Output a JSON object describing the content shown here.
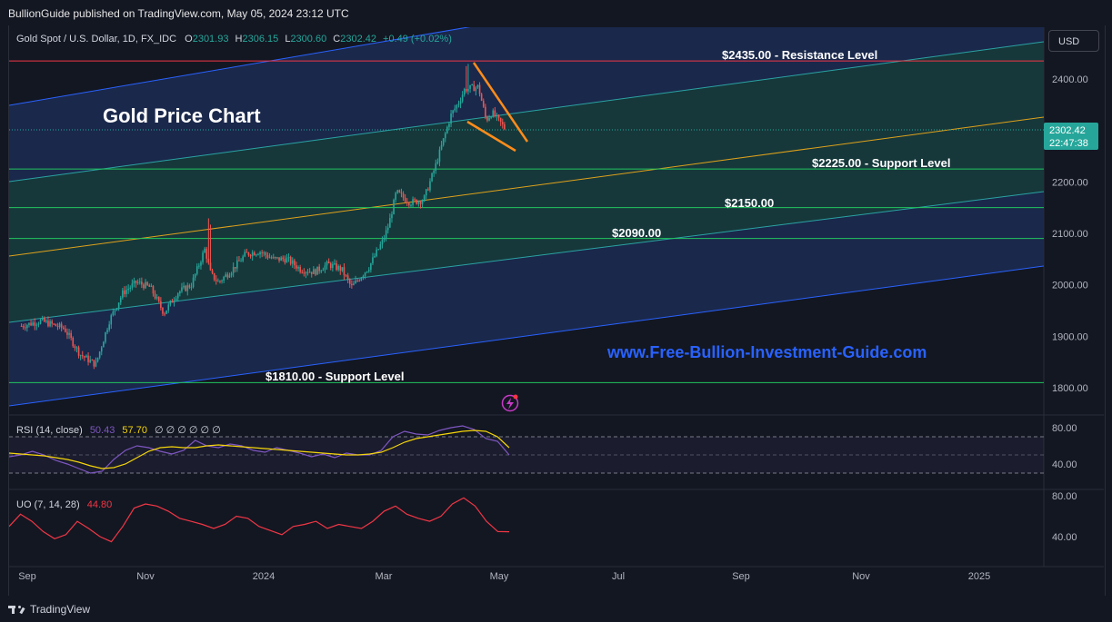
{
  "header": {
    "published": "BullionGuide published on TradingView.com, May 05, 2024 23:12 UTC"
  },
  "footer": {
    "brand": "TradingView"
  },
  "currency_button": "USD",
  "legend": {
    "symbol": "Gold Spot / U.S. Dollar, 1D, FX_IDC",
    "o_label": "O",
    "o": "2301.93",
    "h_label": "H",
    "h": "2306.15",
    "l_label": "L",
    "l": "2300.60",
    "c_label": "C",
    "c": "2302.42",
    "change": "+0.49 (+0.02%)"
  },
  "last_price": {
    "value": "2302.42",
    "countdown": "22:47:38"
  },
  "annotations": {
    "title": "Gold Price Chart",
    "website": "www.Free-Bullion-Investment-Guide.com",
    "resistance": "$2435.00 - Resistance Level",
    "support_2225": "$2225.00 - Support Level",
    "level_2150": "$2150.00",
    "level_2090": "$2090.00",
    "support_1810": "$1810.00 - Support Level"
  },
  "rsi_legend": {
    "label": "RSI (14, close)",
    "v1": "50.43",
    "v2": "57.70",
    "na": "∅ ∅ ∅ ∅ ∅ ∅"
  },
  "uo_legend": {
    "label": "UO (7, 14, 28)",
    "v": "44.80"
  },
  "colors": {
    "background": "#131722",
    "up": "#26a69a",
    "down": "#ef5350",
    "channel_fill": "#1c2b52",
    "inner_fill": "#163a3a",
    "resistance": "#f23645",
    "support": "#22c55e",
    "trend_mid": "#e0a21a",
    "wedge": "#ff8c1a",
    "rsi": "#7e57c2",
    "rsi_ma": "#f5d50b",
    "uo": "#f23645",
    "website": "#2962ff"
  },
  "chart_data": [
    {
      "type": "candlestick",
      "title": "Gold Spot / U.S. Dollar, 1D, FX_IDC",
      "x_ticks": [
        "Sep",
        "Nov",
        "2024",
        "Mar",
        "May",
        "Jul",
        "Sep",
        "Nov",
        "2025"
      ],
      "y_ticks": [
        "1800.00",
        "1900.00",
        "2000.00",
        "2100.00",
        "2200.00",
        "2300.00",
        "2400.00"
      ],
      "ylim": [
        1770,
        2470
      ],
      "series": [
        {
          "name": "",
          "type": "close_path",
          "x": [
            "2023-08-29",
            "2023-09-08",
            "2023-09-20",
            "2023-09-28",
            "2023-10-06",
            "2023-10-13",
            "2023-10-20",
            "2023-10-27",
            "2023-11-03",
            "2023-11-10",
            "2023-11-17",
            "2023-11-24",
            "2023-12-01",
            "2023-12-04",
            "2023-12-08",
            "2023-12-15",
            "2023-12-22",
            "2023-12-29",
            "2024-01-05",
            "2024-01-12",
            "2024-01-19",
            "2024-01-26",
            "2024-02-02",
            "2024-02-09",
            "2024-02-14",
            "2024-02-23",
            "2024-03-01",
            "2024-03-04",
            "2024-03-08",
            "2024-03-15",
            "2024-03-22",
            "2024-03-28",
            "2024-04-05",
            "2024-04-09",
            "2024-04-12",
            "2024-04-19",
            "2024-04-23",
            "2024-04-26",
            "2024-05-03"
          ],
          "values": [
            1920,
            1930,
            1915,
            1865,
            1845,
            1930,
            1985,
            2005,
            1995,
            1945,
            1985,
            2000,
            2070,
            2020,
            2005,
            2030,
            2060,
            2065,
            2050,
            2050,
            2030,
            2025,
            2040,
            2030,
            1995,
            2035,
            2085,
            2115,
            2180,
            2160,
            2165,
            2230,
            2330,
            2355,
            2380,
            2385,
            2320,
            2335,
            2302
          ]
        }
      ],
      "levels": [
        {
          "label": "$2435.00 - Resistance Level",
          "value": 2435
        },
        {
          "label": "$2225.00 - Support Level",
          "value": 2225
        },
        {
          "label": "$2150.00",
          "value": 2150
        },
        {
          "label": "$2090.00",
          "value": 2090
        },
        {
          "label": "$1810.00 - Support Level",
          "value": 1810
        }
      ],
      "last": 2302.42
    },
    {
      "type": "line",
      "title": "RSI (14, close)",
      "y_ticks": [
        "40.00",
        "80.00"
      ],
      "series": [
        {
          "name": "",
          "values": [
            48,
            50,
            54,
            50,
            44,
            40,
            35,
            30,
            32,
            45,
            55,
            60,
            58,
            54,
            51,
            55,
            66,
            60,
            58,
            62,
            60,
            55,
            53,
            58,
            55,
            52,
            48,
            51,
            47,
            52,
            50,
            50,
            55,
            70,
            76,
            73,
            72,
            77,
            80,
            82,
            78,
            68,
            65,
            50
          ]
        },
        {
          "name": "",
          "values": [
            52,
            51,
            50,
            49,
            47,
            45,
            42,
            38,
            35,
            36,
            40,
            47,
            54,
            58,
            59,
            58,
            58,
            60,
            61,
            60,
            59,
            58,
            57,
            56,
            55,
            54,
            53,
            52,
            51,
            50,
            50,
            51,
            53,
            58,
            64,
            68,
            70,
            72,
            74,
            76,
            77,
            76,
            70,
            58
          ]
        }
      ]
    },
    {
      "type": "line",
      "title": "UO (7, 14, 28)",
      "y_ticks": [
        "40.00",
        "80.00"
      ],
      "series": [
        {
          "name": "",
          "values": [
            50,
            62,
            55,
            45,
            38,
            42,
            55,
            48,
            40,
            35,
            50,
            68,
            72,
            70,
            65,
            58,
            55,
            52,
            48,
            52,
            60,
            58,
            50,
            46,
            42,
            50,
            52,
            55,
            48,
            52,
            50,
            48,
            55,
            65,
            70,
            62,
            58,
            55,
            60,
            72,
            78,
            70,
            55,
            45,
            44.8
          ]
        }
      ]
    }
  ]
}
